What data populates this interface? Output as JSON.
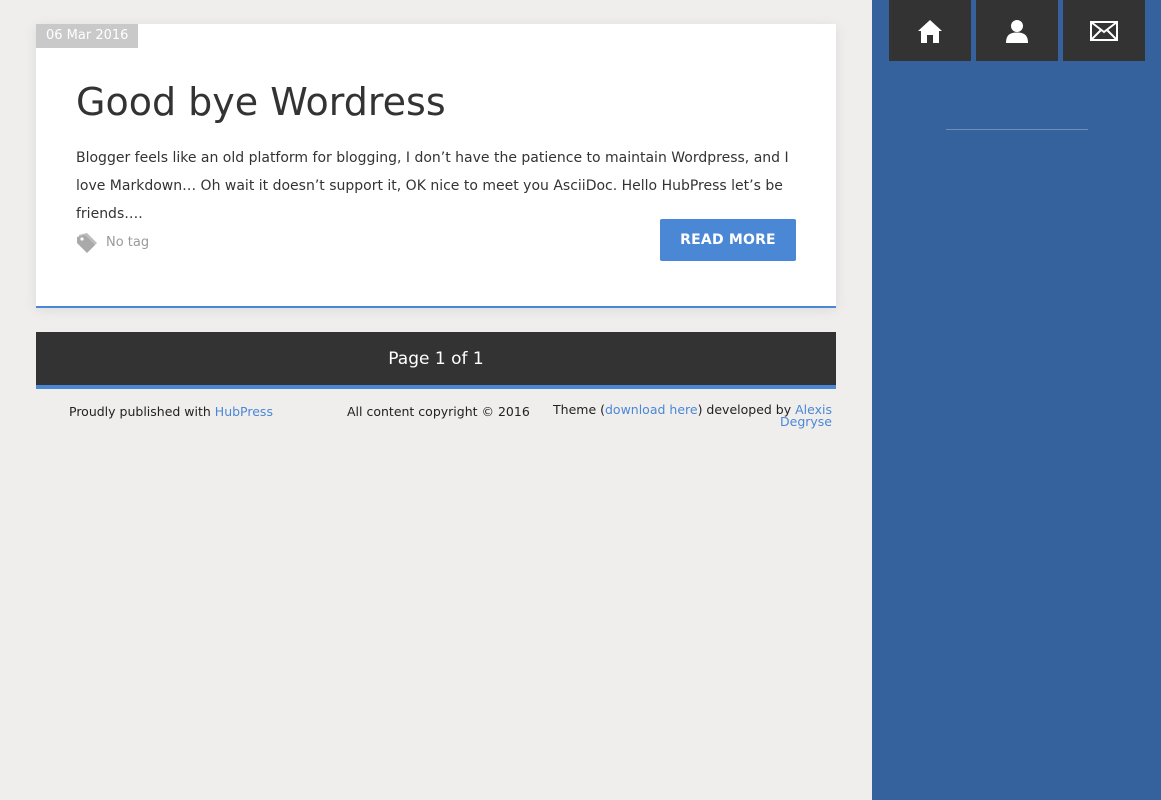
{
  "post": {
    "date": "06 Mar 2016",
    "title": "Good bye Wordress",
    "excerpt": "Blogger feels like an old platform for blogging, I don’t have the patience to maintain Wordpress, and I love Markdown… Oh wait it doesn’t support it, OK nice to meet you AsciiDoc. Hello HubPress let’s be friends….",
    "tags_label": "No tag",
    "tag_icon": "tag-icon",
    "read_more_label": "READ MORE"
  },
  "pagination": {
    "label": "Page 1 of 1"
  },
  "footer": {
    "published_prefix": "Proudly published with ",
    "published_link": "HubPress",
    "copyright": "All content copyright © 2016",
    "theme_prefix": "Theme (",
    "theme_download_link": "download here",
    "theme_middle": ") developed by ",
    "theme_author_link": "Alexis Degryse"
  },
  "sidebar": {
    "nav": [
      {
        "icon": "home-icon"
      },
      {
        "icon": "user-icon"
      },
      {
        "icon": "mail-icon"
      }
    ]
  },
  "colors": {
    "accent": "#4a88d6",
    "sidebar": "#35629c",
    "dark": "#333333",
    "page_background": "#efeeec"
  }
}
